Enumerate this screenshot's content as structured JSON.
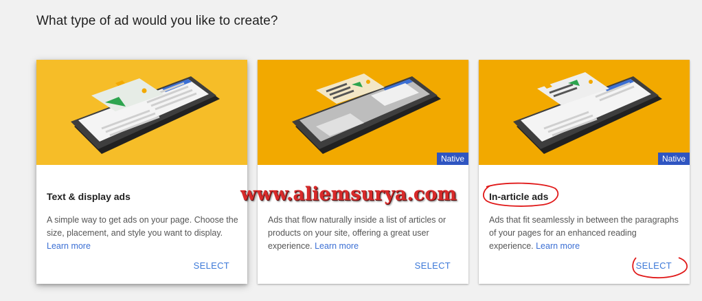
{
  "page": {
    "title": "What type of ad would you like to create?"
  },
  "cards": [
    {
      "title": "Text & display ads",
      "description": "A simple way to get ads on your page. Choose the size, placement, and style you want to display. ",
      "learn_more": "Learn more",
      "select_label": "SELECT",
      "badge": ""
    },
    {
      "title": "",
      "description": "Ads that flow naturally inside a list of articles or products on your site, offering a great user experience. ",
      "learn_more": "Learn more",
      "select_label": "SELECT",
      "badge": "Native"
    },
    {
      "title": "In-article ads",
      "description": "Ads that fit seamlessly in between the paragraphs of your pages for an enhanced reading experience. ",
      "learn_more": "Learn more",
      "select_label": "SELECT",
      "badge": "Native"
    }
  ],
  "watermark": {
    "text": "www.aliemsurya.com"
  },
  "colors": {
    "hero_yellow": "#f6bd28",
    "hero_orange": "#f2a900",
    "badge_blue": "#2f55c1",
    "link_blue": "#3b78d8",
    "annotation_red": "#e01818"
  }
}
